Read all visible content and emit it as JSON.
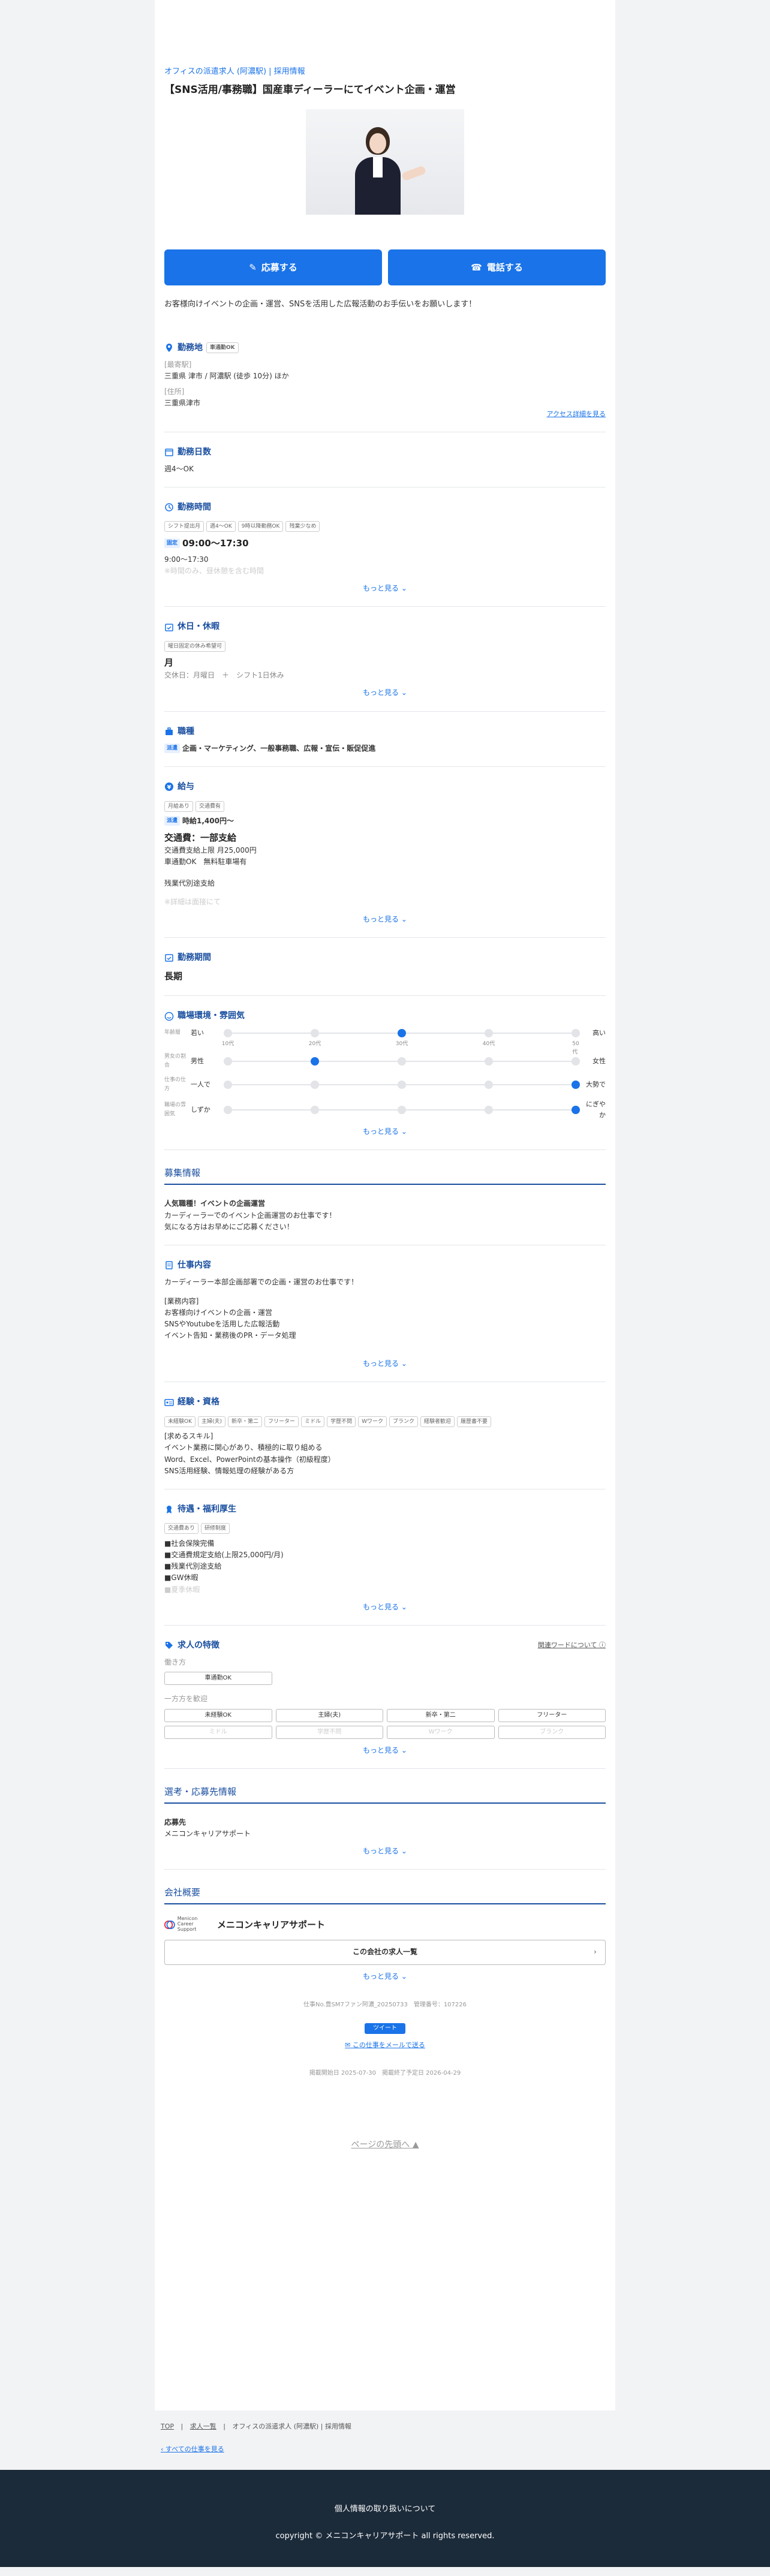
{
  "header": {
    "company": "オフィスの派遣求人 (阿濃駅) | 採用情報",
    "title": "【SNS活用/事務職】国産車ディーラーにてイベント企画・運営"
  },
  "cta": {
    "apply": "応募する",
    "phone": "電話する"
  },
  "lead": "お客様向けイベントの企画・運営、SNSを活用した広報活動のお手伝いをお願いします！",
  "location": {
    "heading": "勤務地",
    "tag": "車通勤OK",
    "station_label": "[最寄駅]",
    "station": "三重県 津市 / 阿濃駅 (徒歩 10分) ほか",
    "address_label": "[住所]",
    "address": "三重県津市",
    "access_link": "アクセス詳細を見る"
  },
  "days": {
    "heading": "勤務日数",
    "value": "週4〜OK"
  },
  "hours": {
    "heading": "勤務時間",
    "tags": [
      "シフト提出月",
      "週4〜OK",
      "9時以降勤務OK",
      "残業少なめ"
    ],
    "badge": "固定",
    "time": "09:00〜17:30",
    "time2": "9:00〜17:30",
    "fade": "※時間のみ、昼休憩を含む時間",
    "more": "もっと見る"
  },
  "holidays": {
    "heading": "休日・休暇",
    "tag": "曜日固定の休み希望可",
    "day": "月",
    "detail": "交休日：月曜日　＋　シフト1日休み",
    "more": "もっと見る"
  },
  "job_type": {
    "heading": "職種",
    "badge": "派遣",
    "value": "企画・マーケティング、一般事務職、広報・宣伝・販促促進"
  },
  "salary": {
    "heading": "給与",
    "tags": [
      "月給あり",
      "交通費有"
    ],
    "badge": "派遣",
    "hourly": "時給1,400円〜",
    "transport": "交通費：一部支給",
    "detail1": "交通費支給上限 月25,000円",
    "detail2": "車通勤OK　無料駐車場有",
    "detail3": "残業代別途支給",
    "fade": "※詳細は面接にて",
    "more": "もっと見る"
  },
  "period": {
    "heading": "勤務期間",
    "value": "長期"
  },
  "environment": {
    "heading": "職場環境・雰囲気",
    "rows": [
      {
        "label": "年齢層",
        "left": "若い",
        "right": "高い",
        "value": 3,
        "dots": 5,
        "ticks": [
          "10代",
          "20代",
          "30代",
          "40代",
          "50代"
        ]
      },
      {
        "label": "男女の割合",
        "left": "男性",
        "right": "女性",
        "value": 2,
        "dots": 5
      },
      {
        "label": "仕事の仕方",
        "left": "一人で",
        "right": "大勢で",
        "value": 5,
        "dots": 5
      },
      {
        "label": "職場の雰囲気",
        "left": "しずか",
        "right": "にぎやか",
        "value": 5,
        "dots": 5
      }
    ],
    "more": "もっと見る"
  },
  "recruit": {
    "block": "募集情報",
    "catch": "人気職種！イベントの企画運営",
    "catch1": "カーディーラーでのイベント企画運営のお仕事です！",
    "catch2": "気になる方はお早めにご応募ください！"
  },
  "work": {
    "heading": "仕事内容",
    "line1": "カーディーラー本部企画部署での企画・運営のお仕事です！",
    "label": "[業務内容]",
    "items": [
      "お客様向けイベントの企画・運営",
      "SNSやYoutubeを活用した広報活動",
      "イベント告知・業務後のPR・データ処理"
    ],
    "more": "もっと見る"
  },
  "skills": {
    "heading": "経験・資格",
    "tags": [
      "未経験OK",
      "主婦(夫)",
      "新卒・第二",
      "フリーター",
      "ミドル",
      "学歴不問",
      "Wワーク",
      "ブランク",
      "経験者歓迎",
      "履歴書不要"
    ],
    "label": "[求めるスキル]",
    "items": [
      "イベント業務に関心があり、積極的に取り組める",
      "Word、Excel、PowerPointの基本操作（初級程度）",
      "SNS活用経験、情報処理の経験がある方"
    ]
  },
  "benefits": {
    "heading": "待遇・福利厚生",
    "tags": [
      "交通費あり",
      "研修制度"
    ],
    "items": [
      "■社会保険完備",
      "■交通費規定支給(上限25,000円/月)",
      "■残業代別途支給",
      "■GW休暇",
      "■夏季休暇"
    ],
    "more": "もっと見る"
  },
  "features": {
    "heading": "求人の特徴",
    "link": "関連ワードについて",
    "group1": "働き方",
    "group1_items": [
      "車通勤OK"
    ],
    "group2": "一方方を歓迎",
    "group2_items": [
      "未経験OK",
      "主婦(夫)",
      "新卒・第二",
      "フリーター",
      "ミドル",
      "学歴不問",
      "Wワーク",
      "ブランク"
    ],
    "more": "もっと見る"
  },
  "selection": {
    "block": "選考・応募先情報",
    "heading": "応募先",
    "value": "メニコンキャリアサポート",
    "more": "もっと見る"
  },
  "company": {
    "block": "会社概要",
    "logo_line1": "Menicon",
    "logo_line2": "Career Support",
    "name": "メニコンキャリアサポート",
    "list_btn": "この会社の求人一覧",
    "more": "もっと見る"
  },
  "meta": {
    "info": "仕事No.豊SM7ファン阿濃_20250733　管理番号：107226",
    "tweet": "ツイート",
    "mail": "この仕事をメールで送る",
    "dates": "掲載開始日 2025-07-30　掲載終了予定日 2026-04-29",
    "page_top": "ページの先頭へ"
  },
  "breadcrumb": [
    "TOP",
    "求人一覧",
    "オフィスの派遣求人 (阿濃駅) | 採用情報"
  ],
  "back_link": "すべての仕事を見る",
  "footer": {
    "privacy": "個人情報の取り扱いについて",
    "copyright": "copyright © メニコンキャリアサポート all rights reserved."
  },
  "colors": {
    "accent": "#1a73e8",
    "heading": "#1a4fa0",
    "footer": "#1c2b3a"
  }
}
